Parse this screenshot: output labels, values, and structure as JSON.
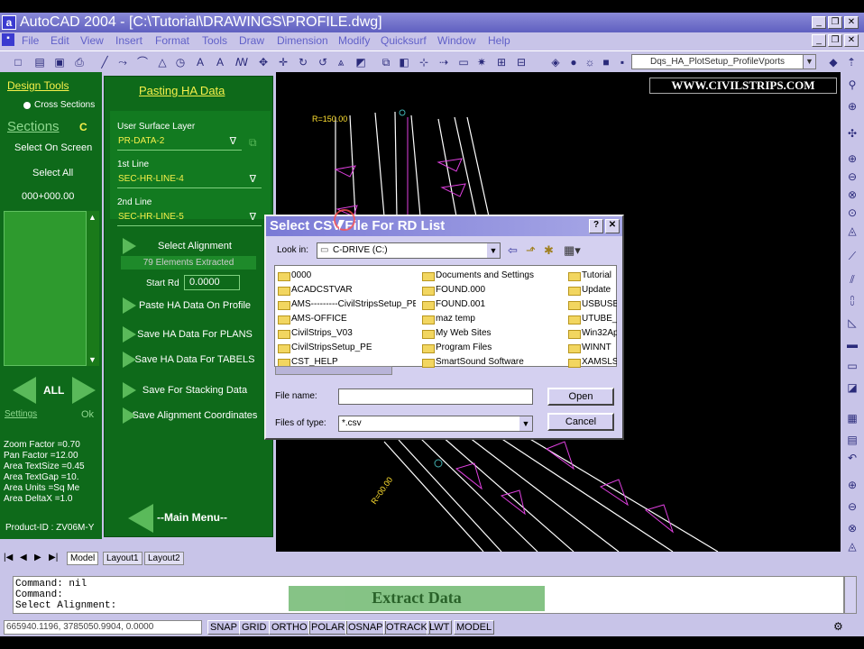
{
  "window": {
    "title": "AutoCAD 2004 - [C:\\Tutorial\\DRAWINGS\\PROFILE.dwg]",
    "app_icon": "a"
  },
  "menu": [
    "File",
    "Edit",
    "View",
    "Insert",
    "Format",
    "Tools",
    "Draw",
    "Dimension",
    "Modify",
    "Quicksurf",
    "Window",
    "Help"
  ],
  "layer_selector": "Dqs_HA_PlotSetup_ProfileVports",
  "watermark": "WWW.CIVILSTRIPS.COM",
  "left_panel": {
    "design_tools": "Design Tools",
    "cross_sections": "Cross Sections",
    "sections": "Sections",
    "sections_key": "C",
    "select_on_screen": "Select On Screen",
    "select_all": "Select All",
    "station": "000+000.00",
    "all_label": "ALL",
    "settings": "Settings",
    "ok": "Ok",
    "info": [
      "Zoom Factor =0.70",
      "Pan Factor =12.00",
      "Area TextSize =0.45",
      "Area TextGap =10.",
      "Area Units =Sq Me",
      "Area DeltaX =1.0"
    ],
    "product_id": "Product-ID : ZV06M-Y"
  },
  "ha_panel": {
    "title": "Pasting HA Data",
    "user_surface_layer_label": "User Surface Layer",
    "user_surface_layer_value": "PR-DATA-2",
    "first_line_label": "1st Line",
    "first_line_value": "SEC-HR-LINE-4",
    "second_line_label": "2nd Line",
    "second_line_value": "SEC-HR-LINE-5",
    "select_alignment": "Select Alignment",
    "elements_extracted": "79 Elements Extracted",
    "start_rd_label": "Start Rd",
    "start_rd_value": "0.0000",
    "paste_profile": "Paste HA Data On Profile",
    "save_plans": "Save HA Data For PLANS",
    "save_tabels": "Save HA Data For TABELS",
    "save_stacking": "Save For Stacking Data",
    "save_coords": "Save Alignment Coordinates",
    "main_menu": "--Main Menu--"
  },
  "dialog": {
    "title": "Select CSV File For RD List",
    "look_in_label": "Look in:",
    "look_in_value": "C-DRIVE (C:)",
    "files_col1": [
      "0000",
      "ACADCSTVAR",
      "AMS---------CivilStripsSetup_PE",
      "AMS-OFFICE",
      "CivilStrips_V03",
      "CivilStripsSetup_PE",
      "CST_HELP"
    ],
    "files_col2": [
      "Documents and Settings",
      "FOUND.000",
      "FOUND.001",
      "maz temp",
      "My Web Sites",
      "Program Files",
      "SmartSound Software"
    ],
    "files_col3": [
      "Tutorial",
      "Update",
      "USBUSB",
      "UTUBE_V",
      "Win32Ap",
      "WINNT",
      "XAMSLSF"
    ],
    "file_name_label": "File name:",
    "file_name_value": "",
    "files_of_type_label": "Files of type:",
    "files_of_type_value": "*.csv",
    "open": "Open",
    "cancel": "Cancel"
  },
  "tabs": [
    "Model",
    "Layout1",
    "Layout2"
  ],
  "command_lines": [
    "Command: nil",
    "Command:",
    "Select Alignment:"
  ],
  "overlay_caption": "Extract Data",
  "coordinates": "665940.1196, 3785050.9904, 0.0000",
  "status_buttons": [
    "SNAP",
    "GRID",
    "ORTHO",
    "POLAR",
    "OSNAP",
    "OTRACK",
    "LWT",
    "MODEL"
  ]
}
